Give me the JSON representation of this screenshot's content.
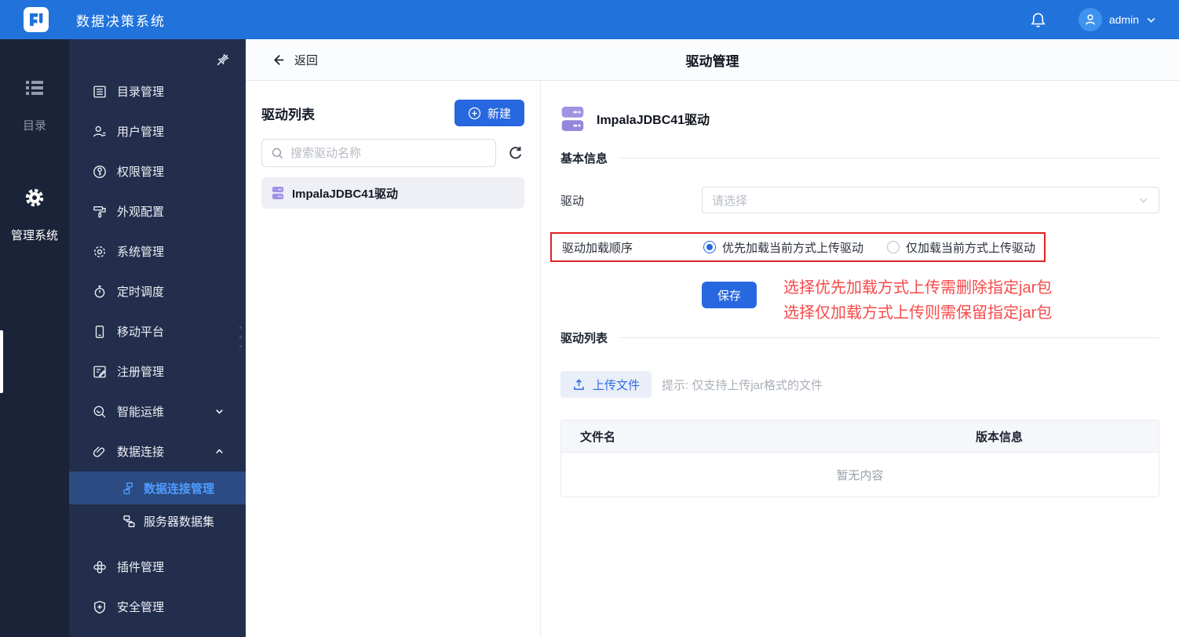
{
  "topbar": {
    "app_title": "数据决策系统",
    "username": "admin"
  },
  "rail": {
    "items": [
      {
        "label": "目录",
        "active": false
      },
      {
        "label": "管理系统",
        "active": true
      }
    ]
  },
  "sidebar": {
    "items": [
      {
        "label": "目录管理"
      },
      {
        "label": "用户管理"
      },
      {
        "label": "权限管理"
      },
      {
        "label": "外观配置"
      },
      {
        "label": "系统管理"
      },
      {
        "label": "定时调度"
      },
      {
        "label": "移动平台"
      },
      {
        "label": "注册管理"
      },
      {
        "label": "智能运维",
        "chevron": "down"
      },
      {
        "label": "数据连接",
        "chevron": "up",
        "expanded": true
      },
      {
        "label": "数据连接管理",
        "sub": true,
        "active": true
      },
      {
        "label": "服务器数据集",
        "sub": true
      },
      {
        "label": "插件管理"
      },
      {
        "label": "安全管理"
      }
    ]
  },
  "header": {
    "back_label": "返回",
    "title": "驱动管理"
  },
  "driver_panel": {
    "title": "驱动列表",
    "new_button": "新建",
    "search_placeholder": "搜索驱动名称",
    "items": [
      {
        "name": "ImpalaJDBC41驱动"
      }
    ]
  },
  "detail": {
    "title": "ImpalaJDBC41驱动",
    "sections": {
      "basic": "基本信息",
      "drivers": "驱动列表"
    },
    "form": {
      "driver_label": "驱动",
      "driver_placeholder": "请选择",
      "load_order_label": "驱动加载顺序",
      "radio_options": [
        {
          "label": "优先加载当前方式上传驱动",
          "selected": true
        },
        {
          "label": "仅加载当前方式上传驱动",
          "selected": false
        }
      ],
      "save_button": "保存"
    },
    "annotations": {
      "line1": "选择优先加载方式上传需删除指定jar包",
      "line2": "选择仅加载方式上传则需保留指定jar包"
    },
    "upload": {
      "button": "上传文件",
      "hint": "提示: 仅支持上传jar格式的文件"
    },
    "table": {
      "columns": [
        "文件名",
        "版本信息"
      ],
      "rows": [],
      "empty_text": "暂无内容"
    }
  },
  "colors": {
    "topbar_blue": "#2173DB",
    "accent_blue": "#2767E0",
    "sidebar_dark": "#1A2337",
    "sidebar_light": "#222E4C",
    "active_nav_bg": "#2B4B82",
    "active_nav_text": "#4F9CFF",
    "annotation_red": "#F84A4A",
    "annotation_box_red": "#E12222",
    "driver_icon_purple": "#A192E4"
  }
}
